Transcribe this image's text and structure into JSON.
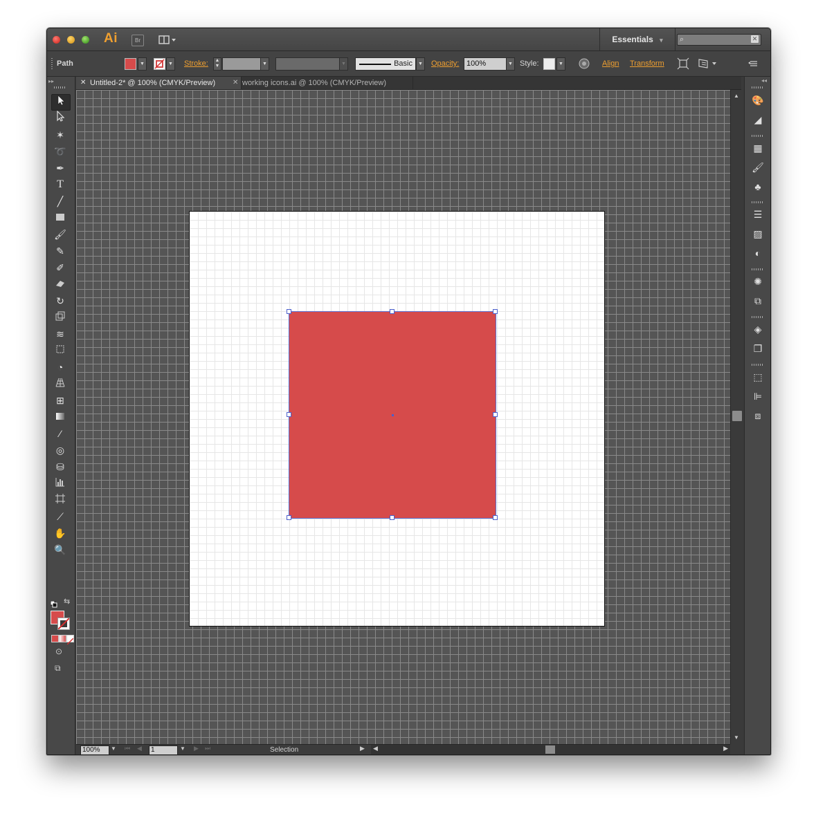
{
  "app": {
    "logo": "Ai",
    "bridge": "Br",
    "workspace": "Essentials",
    "workspace_arrow": "▾"
  },
  "search": {
    "placeholder": "",
    "icon": "search-icon"
  },
  "control_bar": {
    "selection_type": "Path",
    "fill_color": "#d64b4b",
    "stroke_label": "Stroke:",
    "stroke_weight": "",
    "brush_label": "Basic",
    "opacity_label": "Opacity:",
    "opacity_value": "100%",
    "style_label": "Style:",
    "align_label": "Align",
    "transform_label": "Transform"
  },
  "tabs": [
    {
      "label": "Untitled-2* @ 100% (CMYK/Preview)",
      "active": true
    },
    {
      "label": "working icons.ai @ 100% (CMYK/Preview)",
      "active": false
    }
  ],
  "tools": [
    "selection-tool",
    "direct-selection-tool",
    "magic-wand-tool",
    "lasso-tool",
    "pen-tool",
    "type-tool",
    "line-tool",
    "rectangle-tool",
    "paintbrush-tool",
    "pencil-tool",
    "blob-brush-tool",
    "eraser-tool",
    "rotate-tool",
    "scale-tool",
    "width-tool",
    "free-transform-tool",
    "shape-builder-tool",
    "perspective-grid-tool",
    "mesh-tool",
    "gradient-tool",
    "eyedropper-tool",
    "blend-tool",
    "symbol-sprayer-tool",
    "column-graph-tool",
    "artboard-tool",
    "slice-tool",
    "hand-tool",
    "zoom-tool"
  ],
  "canvas": {
    "shape_fill": "#d64b4b",
    "artboard_color": "#ffffff"
  },
  "status": {
    "zoom": "100%",
    "page": "1",
    "tool": "Selection"
  }
}
